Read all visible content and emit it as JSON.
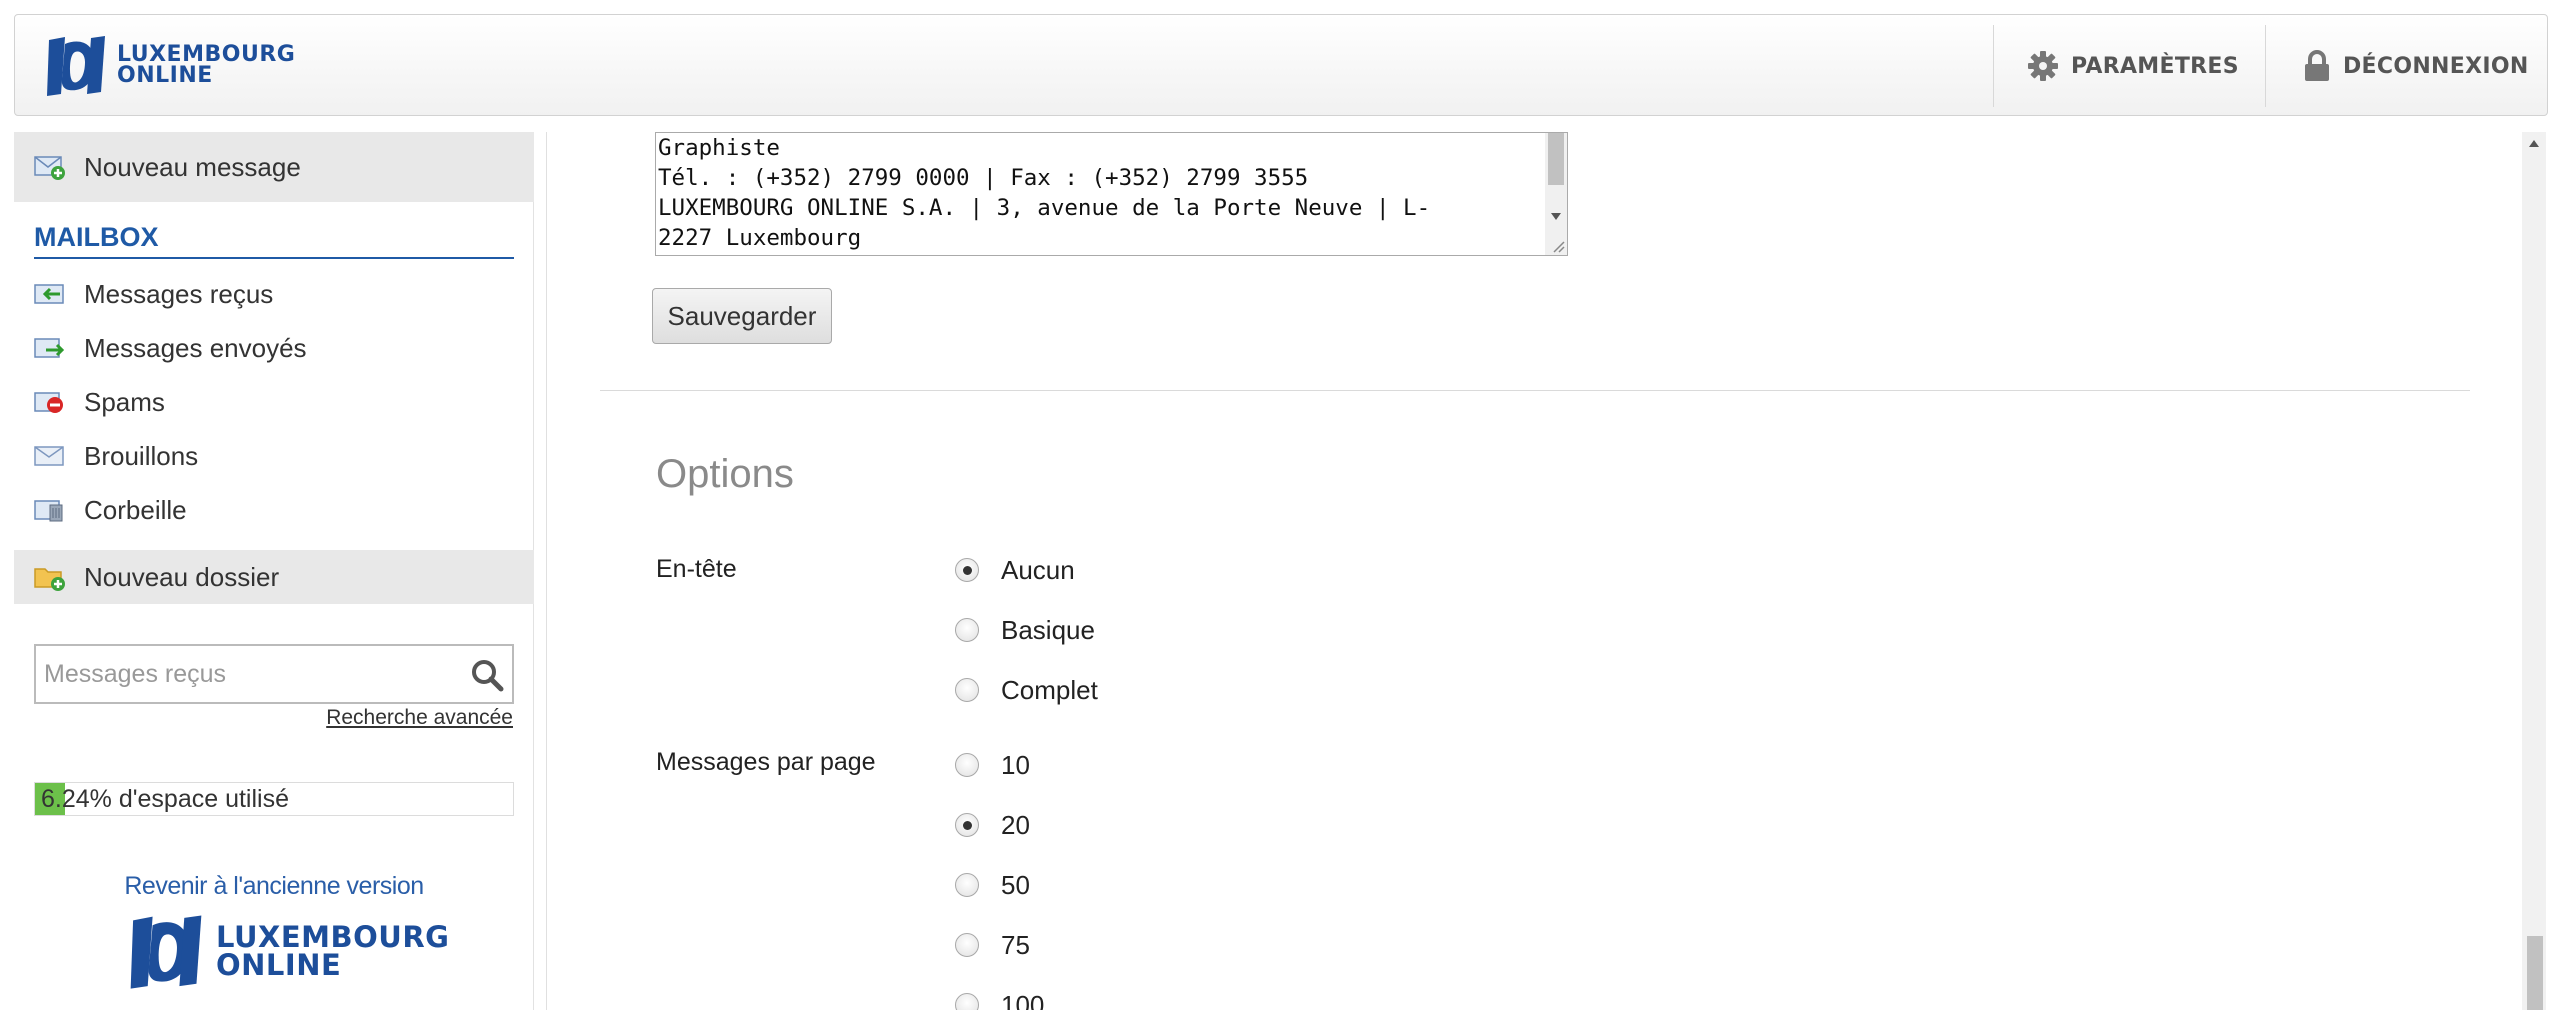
{
  "header": {
    "logo_line1": "LUXEMBOURG",
    "logo_line2": "ONLINE",
    "settings_label": "PARAMÈTRES",
    "logout_label": "DÉCONNEXION"
  },
  "sidebar": {
    "new_message_label": "Nouveau message",
    "mailbox_title": "MAILBOX",
    "folders": [
      {
        "label": "Messages reçus",
        "icon": "inbox-icon"
      },
      {
        "label": "Messages envoyés",
        "icon": "sent-icon"
      },
      {
        "label": "Spams",
        "icon": "spam-icon"
      },
      {
        "label": "Brouillons",
        "icon": "drafts-icon"
      },
      {
        "label": "Corbeille",
        "icon": "trash-icon"
      }
    ],
    "new_folder_label": "Nouveau dossier",
    "search_placeholder": "Messages reçus",
    "advanced_search_label": "Recherche avancée",
    "quota": {
      "percent": 6.24,
      "label": "6.24% d'espace utilisé",
      "fill_color": "#6cc04a"
    },
    "old_version_label": "Revenir à l'ancienne version",
    "bottom_logo_line1": "LUXEMBOURG",
    "bottom_logo_line2": "ONLINE"
  },
  "signature": {
    "lines": [
      "Graphiste",
      "Tél. : (+352) 2799 0000 | Fax : (+352) 2799 3555",
      "LUXEMBOURG ONLINE S.A. | 3, avenue de la Porte Neuve | L-",
      "2227 Luxembourg"
    ]
  },
  "save_label": "Sauvegarder",
  "options": {
    "title": "Options",
    "header_label": "En-tête",
    "header_choices": [
      {
        "label": "Aucun",
        "selected": true
      },
      {
        "label": "Basique",
        "selected": false
      },
      {
        "label": "Complet",
        "selected": false
      }
    ],
    "per_page_label": "Messages par page",
    "per_page_choices": [
      {
        "label": "10",
        "selected": false
      },
      {
        "label": "20",
        "selected": true
      },
      {
        "label": "50",
        "selected": false
      },
      {
        "label": "75",
        "selected": false
      },
      {
        "label": "100",
        "selected": false
      }
    ]
  },
  "colors": {
    "brand_blue": "#1d4e9a",
    "link_blue": "#2a5ea8"
  }
}
